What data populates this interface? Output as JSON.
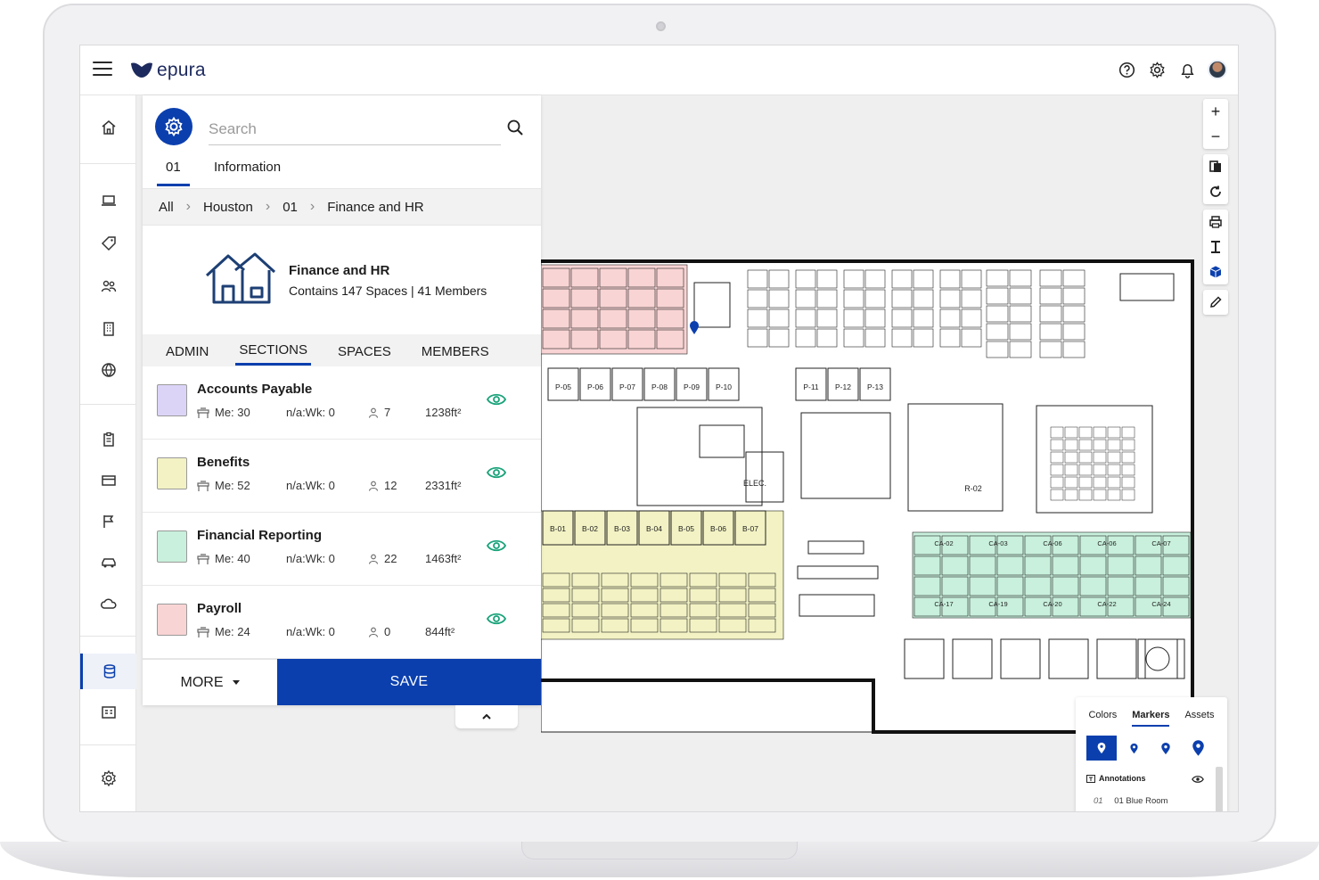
{
  "app": {
    "name": "epura"
  },
  "topbar": {
    "icons": [
      "help-icon",
      "settings-icon",
      "bell-icon",
      "user-avatar"
    ]
  },
  "nav": {
    "items": [
      "home-icon",
      "laptop-icon",
      "tag-icon",
      "people-icon",
      "building-icon",
      "globe-icon",
      "clipboard-icon",
      "card-icon",
      "flag-icon",
      "car-icon",
      "cloud-icon",
      "database-icon",
      "id-card-icon",
      "settings-icon"
    ]
  },
  "panel": {
    "search": {
      "placeholder": "Search"
    },
    "tabs": {
      "number": "01",
      "information": "Information"
    },
    "breadcrumb": [
      "All",
      "Houston",
      "01",
      "Finance and HR"
    ],
    "info": {
      "title": "Finance and HR",
      "subtitle": "Contains 147 Spaces | 41 Members"
    },
    "subtabs": [
      "ADMIN",
      "SECTIONS",
      "SPACES",
      "MEMBERS"
    ],
    "sections": [
      {
        "name": "Accounts Payable",
        "me": "Me: 30",
        "wk": "n/a:Wk: 0",
        "people": "7",
        "area": "1238ft²",
        "color": "#dcd4f7"
      },
      {
        "name": "Benefits",
        "me": "Me: 52",
        "wk": "n/a:Wk: 0",
        "people": "12",
        "area": "2331ft²",
        "color": "#f2f2c4"
      },
      {
        "name": "Financial Reporting",
        "me": "Me: 40",
        "wk": "n/a:Wk: 0",
        "people": "22",
        "area": "1463ft²",
        "color": "#c8f0dc"
      },
      {
        "name": "Payroll",
        "me": "Me: 24",
        "wk": "n/a:Wk: 0",
        "people": "0",
        "area": "844ft²",
        "color": "#f9d4d4"
      }
    ],
    "footer": {
      "more": "MORE",
      "save": "SAVE"
    }
  },
  "map": {
    "labels": {
      "row_p": [
        "P-05",
        "P-06",
        "P-07",
        "P-08",
        "P-09",
        "P-10",
        "P-11",
        "P-12",
        "P-13"
      ],
      "row_b": [
        "B-01",
        "B-02",
        "B-03",
        "B-04",
        "B-05",
        "B-06",
        "B-07"
      ],
      "elec": "ELEC.",
      "r02": "R-02",
      "ca_top": [
        "CA-02",
        "CA-03",
        "CA-06",
        "CA-06",
        "CA-07"
      ],
      "ca_bot": [
        "CA-17",
        "CA-19",
        "CA-20",
        "CA-22",
        "CA-24"
      ]
    },
    "zone_colors": {
      "payroll": "#f9d4d4",
      "benefits": "#f2f2c4",
      "financial_reporting": "#c8f0dc"
    }
  },
  "toolbar": {
    "zoom_in": "+",
    "zoom_out": "−"
  },
  "legend": {
    "tabs": [
      "Colors",
      "Markers",
      "Assets"
    ],
    "active_tab": "Markers",
    "annotations": "Annotations",
    "room_num": "01",
    "room": "01 Blue Room"
  }
}
